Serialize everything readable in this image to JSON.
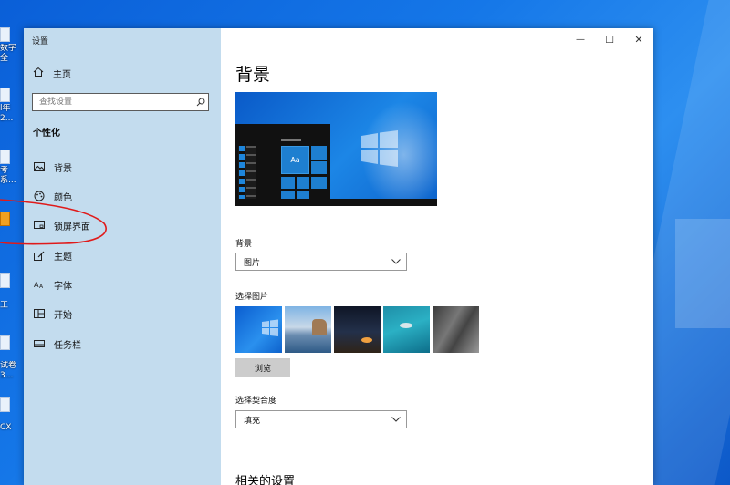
{
  "window": {
    "title": "设置",
    "controls": {
      "minimize": "—",
      "maximize": "☐",
      "close": "✕"
    }
  },
  "sidebar": {
    "home_label": "主页",
    "search_placeholder": "查找设置",
    "section_title": "个性化",
    "items": [
      {
        "label": "背景",
        "icon": "picture-icon"
      },
      {
        "label": "颜色",
        "icon": "palette-icon"
      },
      {
        "label": "锁屏界面",
        "icon": "lock-screen-icon"
      },
      {
        "label": "主题",
        "icon": "theme-brush-icon"
      },
      {
        "label": "字体",
        "icon": "font-icon"
      },
      {
        "label": "开始",
        "icon": "start-grid-icon"
      },
      {
        "label": "任务栏",
        "icon": "taskbar-icon"
      }
    ]
  },
  "main": {
    "page_title": "背景",
    "preview_text": "Aa",
    "background_label": "背景",
    "background_value": "图片",
    "choose_picture_label": "选择图片",
    "browse_button": "浏览",
    "fit_label": "选择契合度",
    "fit_value": "填充",
    "related_title": "相关的设置"
  },
  "desktop": {
    "icon_labels": [
      "数字\n全",
      "l年\n2...",
      "考\n系...",
      "",
      "工",
      "试卷\n3...",
      "CX"
    ]
  },
  "colors": {
    "sidebar_bg": "#c3dcee",
    "accent": "#0078d7",
    "annotation": "#e01a1a"
  }
}
